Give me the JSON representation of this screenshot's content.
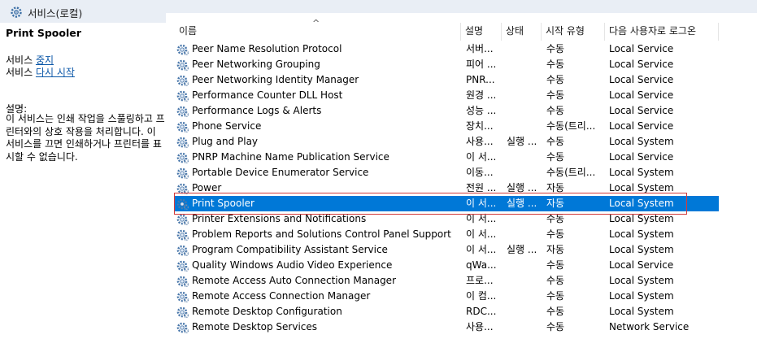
{
  "header": {
    "title": "서비스(로컬)",
    "icon": "gear-icon"
  },
  "left_pane": {
    "service_name": "Print Spooler",
    "actions": [
      {
        "prefix": "서비스 ",
        "link": "중지"
      },
      {
        "prefix": "서비스 ",
        "link": "다시 시작"
      }
    ],
    "description_label": "설명:",
    "description": "이 서비스는 인쇄 작업을 스풀링하고 프린터와의 상호 작용을 처리합니다. 이 서비스를 끄면 인쇄하거나 프린터를 표시할 수 없습니다."
  },
  "columns": {
    "name": "이름",
    "desc": "설명",
    "status": "상태",
    "start": "시작 유형",
    "logon": "다음 사용자로 로그온",
    "sort_indicator": "^"
  },
  "rows": [
    {
      "name": "Peer Name Resolution Protocol",
      "desc": "서버...",
      "status": "",
      "start": "수동",
      "logon": "Local Service"
    },
    {
      "name": "Peer Networking Grouping",
      "desc": "피어 ...",
      "status": "",
      "start": "수동",
      "logon": "Local Service"
    },
    {
      "name": "Peer Networking Identity Manager",
      "desc": "PNR...",
      "status": "",
      "start": "수동",
      "logon": "Local Service"
    },
    {
      "name": "Performance Counter DLL Host",
      "desc": "원경 ...",
      "status": "",
      "start": "수동",
      "logon": "Local Service"
    },
    {
      "name": "Performance Logs & Alerts",
      "desc": "성능 ...",
      "status": "",
      "start": "수동",
      "logon": "Local Service"
    },
    {
      "name": "Phone Service",
      "desc": "장치...",
      "status": "",
      "start": "수동(트리...",
      "logon": "Local Service"
    },
    {
      "name": "Plug and Play",
      "desc": "사용...",
      "status": "실행 ...",
      "start": "수동",
      "logon": "Local System"
    },
    {
      "name": "PNRP Machine Name Publication Service",
      "desc": "이 서...",
      "status": "",
      "start": "수동",
      "logon": "Local Service"
    },
    {
      "name": "Portable Device Enumerator Service",
      "desc": "이동...",
      "status": "",
      "start": "수동(트리...",
      "logon": "Local System"
    },
    {
      "name": "Power",
      "desc": "전원 ...",
      "status": "실행 ...",
      "start": "자동",
      "logon": "Local System"
    },
    {
      "name": "Print Spooler",
      "desc": "이 서...",
      "status": "실행 ...",
      "start": "자동",
      "logon": "Local System",
      "selected": true
    },
    {
      "name": "Printer Extensions and Notifications",
      "desc": "이 서...",
      "status": "",
      "start": "수동",
      "logon": "Local System"
    },
    {
      "name": "Problem Reports and Solutions Control Panel Support",
      "desc": "이 서...",
      "status": "",
      "start": "수동",
      "logon": "Local System"
    },
    {
      "name": "Program Compatibility Assistant Service",
      "desc": "이 서...",
      "status": "실행 ...",
      "start": "자동",
      "logon": "Local System"
    },
    {
      "name": "Quality Windows Audio Video Experience",
      "desc": "qWa...",
      "status": "",
      "start": "수동",
      "logon": "Local Service"
    },
    {
      "name": "Remote Access Auto Connection Manager",
      "desc": "프로...",
      "status": "",
      "start": "수동",
      "logon": "Local System"
    },
    {
      "name": "Remote Access Connection Manager",
      "desc": "이 컴...",
      "status": "",
      "start": "수동",
      "logon": "Local System"
    },
    {
      "name": "Remote Desktop Configuration",
      "desc": "RDC...",
      "status": "",
      "start": "수동",
      "logon": "Local System"
    },
    {
      "name": "Remote Desktop Services",
      "desc": "사용...",
      "status": "",
      "start": "수동",
      "logon": "Network Service"
    }
  ]
}
